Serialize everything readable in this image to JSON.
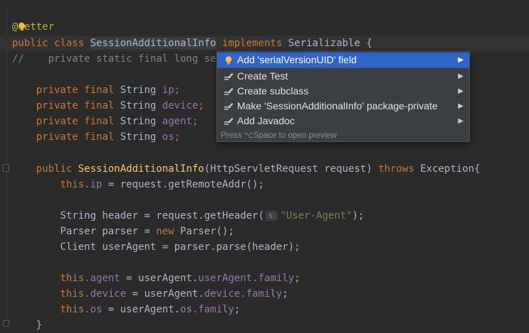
{
  "code": {
    "line0": {
      "text": "@Getter"
    },
    "line1": {
      "kw1": "public",
      "kw2": "class",
      "classname": "SessionAdditionalInfo",
      "kw3": "implements",
      "iface": "Serializable",
      "brace": "{"
    },
    "line2": {
      "comment": "//    private static final long se"
    },
    "line3": {
      "kw1": "private",
      "kw2": "final",
      "type": "String",
      "name": "ip",
      "end": ";"
    },
    "line4": {
      "kw1": "private",
      "kw2": "final",
      "type": "String",
      "name": "device",
      "end": ";"
    },
    "line5": {
      "kw1": "private",
      "kw2": "final",
      "type": "String",
      "name": "agent",
      "end": ";"
    },
    "line6": {
      "kw1": "private",
      "kw2": "final",
      "type": "String",
      "name": "os",
      "end": ";"
    },
    "line7": {
      "kw1": "public",
      "ctor": "SessionAdditionalInfo",
      "params": "(HttpServletRequest request)",
      "kw2": "throws",
      "exc": "Exception{"
    },
    "line8": {
      "this": "this",
      "field": ".ip",
      "rest": " = request.getRemoteAddr();"
    },
    "line9": {
      "pre": "String header = request.getHeader(",
      "hint": "s:",
      "str": "\"User-Agent\"",
      "post": ");"
    },
    "line10": {
      "pre": "Parser parser = ",
      "kw": "new",
      "post": " Parser();"
    },
    "line11": {
      "text": "Client userAgent = parser.parse(header);"
    },
    "line12": {
      "this": "this",
      "field": ".agent",
      "eq": " = userAgent.",
      "f1": "userAgent",
      "f2": ".family",
      "end": ";"
    },
    "line13": {
      "this": "this",
      "field": ".device",
      "eq": " = userAgent.",
      "f1": "device",
      "f2": ".family",
      "end": ";"
    },
    "line14": {
      "this": "this",
      "field": ".os",
      "eq": " = userAgent.",
      "f1": "os",
      "f2": ".family",
      "end": ";"
    },
    "line15": {
      "text": "}"
    }
  },
  "popup": {
    "items": [
      {
        "label": "Add 'serialVersionUID' field",
        "icon": "lightbulb-icon",
        "selected": true
      },
      {
        "label": "Create Test",
        "icon": "intention-pencil-icon"
      },
      {
        "label": "Create subclass",
        "icon": "intention-pencil-icon"
      },
      {
        "label": "Make 'SessionAdditionalInfo' package-private",
        "icon": "intention-pencil-icon"
      },
      {
        "label": "Add Javadoc",
        "icon": "intention-pencil-icon"
      }
    ],
    "footer": "Press ⌥Space to open preview"
  },
  "colors": {
    "background": "#2b2b2b",
    "keyword": "#cc7832",
    "annotation": "#bbb529",
    "method": "#ffc66d",
    "field": "#9876aa",
    "string": "#6a8759",
    "comment": "#808080",
    "selection": "#2f65ca"
  }
}
